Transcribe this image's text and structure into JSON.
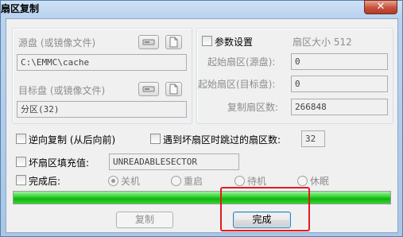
{
  "window": {
    "title": "扇区复制",
    "close_label": "✕"
  },
  "source": {
    "label": "源盘 (或镜像文件)",
    "value": "C:\\EMMC\\cache",
    "disk_icon": "disk-drive-icon",
    "file_icon": "file-icon"
  },
  "target": {
    "label": "目标盘 (或镜像文件)",
    "value": "分区(32)",
    "disk_icon": "disk-drive-icon",
    "file_icon": "file-icon"
  },
  "params": {
    "checkbox_label": "参数设置",
    "sector_size_label": "扇区大小 512",
    "start_source_label": "起始扇区(源盘):",
    "start_source_value": "0",
    "start_target_label": "起始扇区(目标盘):",
    "start_target_value": "0",
    "count_label": "复制扇区数:",
    "count_value": "266848"
  },
  "options": {
    "reverse_label": "逆向复制 (从后向前)",
    "skip_label": "遇到坏扇区时跳过的扇区数:",
    "skip_value": "32",
    "fill_label": "坏扇区填充值:",
    "fill_value": "UNREADABLESECTOR"
  },
  "after": {
    "label": "完成后:",
    "choices": [
      "关机",
      "重启",
      "待机",
      "休眠"
    ],
    "selected": "关机"
  },
  "progress": {
    "fraction": 1.0
  },
  "buttons": {
    "copy": "复制",
    "done": "完成"
  },
  "colors": {
    "progress": "#0bbf0b",
    "highlight": "#e21b1b"
  }
}
